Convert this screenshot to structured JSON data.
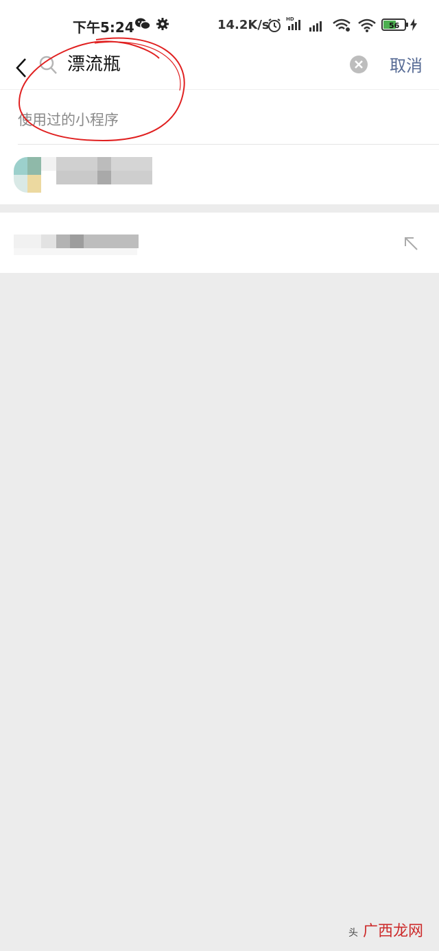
{
  "status": {
    "time": "下午5:24",
    "net_speed": "14.2K/s",
    "battery": "56",
    "battery_color": "#4caf50"
  },
  "search": {
    "query": "漂流瓶",
    "cancel_label": "取消"
  },
  "section": {
    "title": "使用过的小程序"
  },
  "watermark": {
    "text": "广西龙网",
    "prefix": "头"
  },
  "colors": {
    "link": "#576b95",
    "marker": "#e02020",
    "background": "#ececec"
  }
}
